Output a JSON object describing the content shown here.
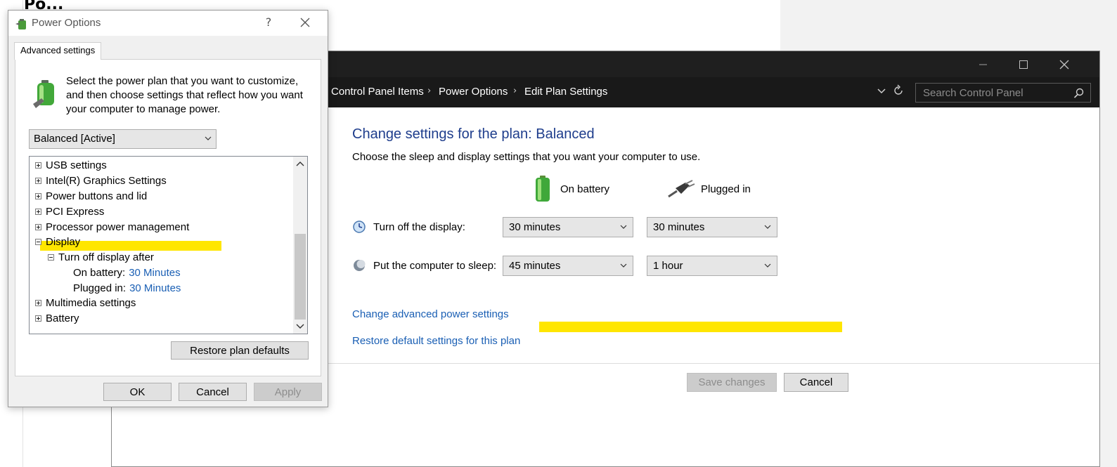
{
  "background": {
    "title": "Po..."
  },
  "control_panel": {
    "breadcrumbs": [
      "Control Panel Items",
      "Power Options",
      "Edit Plan Settings"
    ],
    "search": {
      "placeholder": "Search Control Panel"
    },
    "heading": "Change settings for the plan: Balanced",
    "subheading": "Choose the sleep and display settings that you want your computer to use.",
    "columns": {
      "battery": "On battery",
      "plugged": "Plugged in"
    },
    "rows": [
      {
        "label": "Turn off the display:",
        "battery": "30 minutes",
        "plugged": "30 minutes",
        "icon": "display-icon"
      },
      {
        "label": "Put the computer to sleep:",
        "battery": "45 minutes",
        "plugged": "1 hour",
        "icon": "sleep-moon-icon"
      }
    ],
    "links": {
      "advanced": "Change advanced power settings",
      "restore": "Restore default settings for this plan"
    },
    "buttons": {
      "save": "Save changes",
      "cancel": "Cancel"
    },
    "highlight_color": "#ffe600",
    "heading_color": "#1e3d8c",
    "link_color": "#1a5fb4"
  },
  "power_dialog": {
    "title": "Power Options",
    "help": "?",
    "tab": "Advanced settings",
    "intro": "Select the power plan that you want to customize, and then choose settings that reflect how you want your computer to manage power.",
    "plan_selected": "Balanced [Active]",
    "tree": [
      {
        "label": "USB settings",
        "expander": "plus"
      },
      {
        "label": "Intel(R) Graphics Settings",
        "expander": "plus"
      },
      {
        "label": "Power buttons and lid",
        "expander": "plus"
      },
      {
        "label": "PCI Express",
        "expander": "plus"
      },
      {
        "label": "Processor power management",
        "expander": "plus"
      },
      {
        "label": "Display",
        "expander": "minus"
      },
      {
        "label": "Turn off display after",
        "expander": "minus"
      },
      {
        "label": "On battery:",
        "value": "30 Minutes"
      },
      {
        "label": "Plugged in:",
        "value": "30 Minutes"
      },
      {
        "label": "Multimedia settings",
        "expander": "plus"
      },
      {
        "label": "Battery",
        "expander": "plus"
      }
    ],
    "buttons": {
      "restore": "Restore plan defaults",
      "ok": "OK",
      "cancel": "Cancel",
      "apply": "Apply"
    }
  }
}
